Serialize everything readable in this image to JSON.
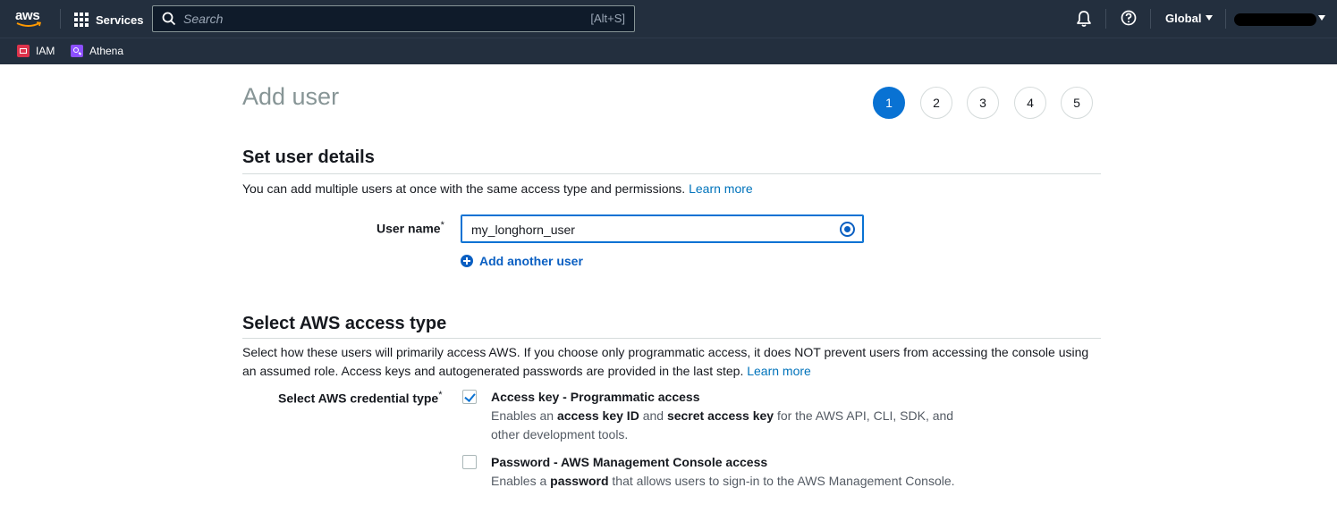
{
  "nav": {
    "logo_text": "aws",
    "services_label": "Services",
    "search_placeholder": "Search",
    "search_shortcut": "[Alt+S]",
    "region_label": "Global"
  },
  "favorites": [
    {
      "label": "IAM",
      "icon": "iam-icon",
      "color": "#dd344c"
    },
    {
      "label": "Athena",
      "icon": "athena-icon",
      "color": "#8c4fff"
    }
  ],
  "page": {
    "title": "Add user",
    "steps": [
      "1",
      "2",
      "3",
      "4",
      "5"
    ],
    "active_step": "1"
  },
  "user_details": {
    "section_title": "Set user details",
    "description": "You can add multiple users at once with the same access type and permissions.",
    "learn_more": "Learn more",
    "user_name_label": "User name",
    "required_mark": "*",
    "user_name_value": "my_longhorn_user",
    "add_another_user": "Add another user"
  },
  "access_type": {
    "section_title": "Select AWS access type",
    "description": "Select how these users will primarily access AWS. If you choose only programmatic access, it does NOT prevent users from accessing the console using an assumed role. Access keys and autogenerated passwords are provided in the last step.",
    "learn_more": "Learn more",
    "credential_label": "Select AWS credential type",
    "options": [
      {
        "title": "Access key - Programmatic access",
        "checked": true,
        "desc_parts": [
          "Enables an ",
          "access key ID",
          " and ",
          "secret access key",
          " for the AWS API, CLI, SDK, and other development tools."
        ]
      },
      {
        "title": "Password - AWS Management Console access",
        "checked": false,
        "desc_parts": [
          "Enables a ",
          "password",
          " that allows users to sign-in to the AWS Management Console."
        ]
      }
    ]
  },
  "colors": {
    "nav_bg": "#232f3e",
    "primary_blue": "#0972d3",
    "link_blue": "#0073bb"
  }
}
